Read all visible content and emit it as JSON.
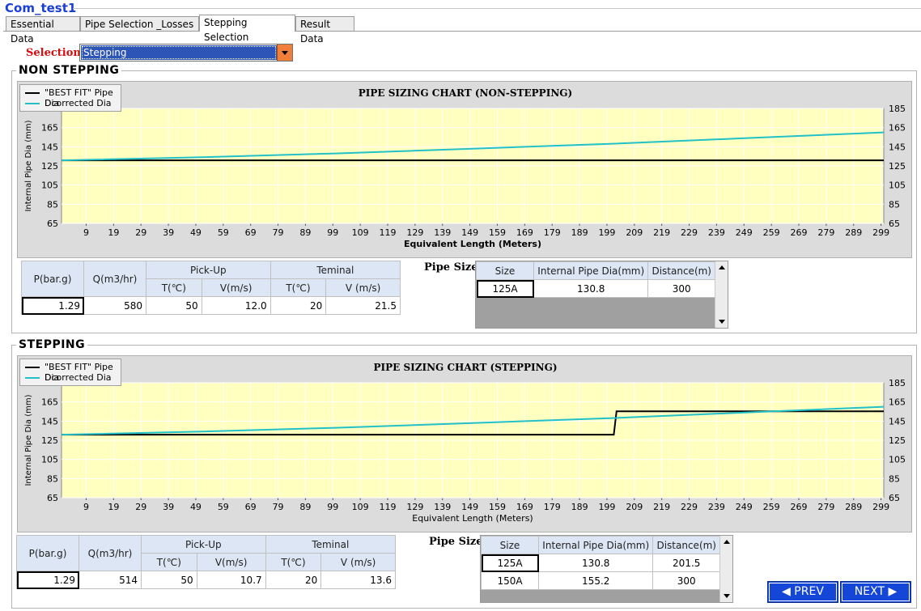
{
  "window": {
    "title": "Com_test1"
  },
  "tabs": [
    {
      "label": "Essential Data"
    },
    {
      "label": "Pipe Selection _Losses"
    },
    {
      "label": "Stepping Selection"
    },
    {
      "label": "Result Data"
    }
  ],
  "selection": {
    "label": "Selection",
    "value": "Stepping"
  },
  "sections": [
    {
      "group_label": "NON STEPPING",
      "legend": [
        {
          "name": "\"BEST FIT\" Pipe Dia",
          "color": "#000000"
        },
        {
          "name": "Dcorrected Dia",
          "color": "#22c0c8"
        }
      ],
      "chart_data": {
        "type": "line",
        "title": "PIPE SIZING CHART (NON-STEPPING)",
        "xlabel": "Equivalent Length (Meters)",
        "ylabel": "Internal Pipe Dia (mm)",
        "x_ticks": [
          9,
          19,
          29,
          39,
          49,
          59,
          69,
          79,
          89,
          99,
          109,
          119,
          129,
          139,
          149,
          159,
          169,
          179,
          189,
          199,
          209,
          219,
          229,
          239,
          249,
          259,
          269,
          279,
          289,
          299
        ],
        "y_ticks": [
          65,
          85,
          105,
          125,
          145,
          165,
          185
        ],
        "xlim": [
          0,
          300
        ],
        "ylim": [
          65,
          185
        ],
        "series": [
          {
            "name": "\"BEST FIT\" Pipe Dia",
            "color": "#000000",
            "x": [
              0,
              300
            ],
            "y": [
              130.8,
              130.8
            ]
          },
          {
            "name": "Dcorrected Dia",
            "color": "#22c0c8",
            "x": [
              0,
              50,
              100,
              150,
              200,
              250,
              300
            ],
            "y": [
              130.8,
              134,
              138,
              143,
              148,
              154,
              160
            ]
          }
        ]
      },
      "table": {
        "headers": {
          "p": "P(bar.g)",
          "q": "Q(m3/hr)",
          "pickup": "Pick-Up",
          "terminal": "Teminal",
          "t": "T(℃)",
          "v": "V(m/s)",
          "v2": "V (m/s)"
        },
        "values": {
          "p": "1.29",
          "q": "580",
          "pickup_t": "50",
          "pickup_v": "12.0",
          "terminal_t": "20",
          "terminal_v": "21.5"
        }
      },
      "pipe_size": {
        "label": "Pipe Size",
        "headers": [
          "Size",
          "Internal Pipe Dia(mm)",
          "Distance(m)"
        ],
        "rows": [
          [
            "125A",
            "130.8",
            "300"
          ]
        ]
      }
    },
    {
      "group_label": "STEPPING",
      "legend": [
        {
          "name": "\"BEST FIT\" Pipe Dia",
          "color": "#000000"
        },
        {
          "name": "Dcorrected Dia",
          "color": "#22c0c8"
        }
      ],
      "chart_data": {
        "type": "line",
        "title": "PIPE SIZING CHART (STEPPING)",
        "xlabel": "Equivalent Length (Meters)",
        "ylabel": "Internal Pipe Dia (mm)",
        "x_ticks": [
          9,
          19,
          29,
          39,
          49,
          59,
          69,
          79,
          89,
          99,
          109,
          119,
          129,
          139,
          149,
          159,
          169,
          179,
          189,
          199,
          209,
          219,
          229,
          239,
          249,
          259,
          269,
          279,
          289,
          299
        ],
        "y_ticks": [
          65,
          85,
          105,
          125,
          145,
          165,
          185
        ],
        "xlim": [
          0,
          300
        ],
        "ylim": [
          65,
          185
        ],
        "series": [
          {
            "name": "\"BEST FIT\" Pipe Dia",
            "color": "#000000",
            "x": [
              0,
              201.5,
              202.5,
              300
            ],
            "y": [
              130.8,
              130.8,
              155.2,
              155.2
            ]
          },
          {
            "name": "Dcorrected Dia",
            "color": "#22c0c8",
            "x": [
              0,
              50,
              100,
              150,
              200,
              250,
              300
            ],
            "y": [
              130.8,
              134,
              138,
              143,
              148,
              154,
              160
            ]
          }
        ]
      },
      "table": {
        "headers": {
          "p": "P(bar.g)",
          "q": "Q(m3/hr)",
          "pickup": "Pick-Up",
          "terminal": "Teminal",
          "t": "T(℃)",
          "v": "V(m/s)",
          "v2": "V (m/s)"
        },
        "values": {
          "p": "1.29",
          "q": "514",
          "pickup_t": "50",
          "pickup_v": "10.7",
          "terminal_t": "20",
          "terminal_v": "13.6"
        }
      },
      "pipe_size": {
        "label": "Pipe Size",
        "headers": [
          "Size",
          "Internal Pipe Dia(mm)",
          "Distance(m)"
        ],
        "rows": [
          [
            "125A",
            "130.8",
            "201.5"
          ],
          [
            "150A",
            "155.2",
            "300"
          ]
        ]
      }
    }
  ],
  "nav": {
    "prev": "◀ PREV",
    "next": "NEXT ▶"
  }
}
